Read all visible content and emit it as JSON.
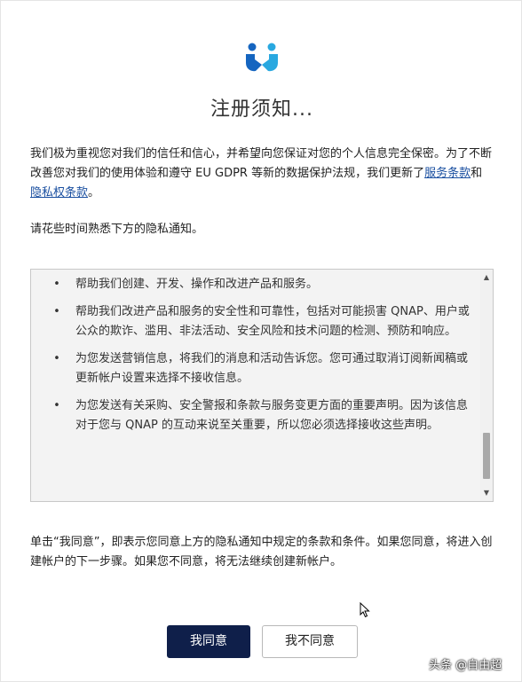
{
  "dialog": {
    "title": "注册须知...",
    "intro": {
      "text_before": "我们极为重视您对我们的信任和信心，并希望向您保证对您的个人信息完全保密。为了不断改善您对我们的使用体验和遵守 EU GDPR 等新的数据保护法规，我们更新了",
      "terms_link": "服务条款",
      "and": "和",
      "privacy_link": "隐私权条款",
      "text_after": "。"
    },
    "hint": "请花些时间熟悉下方的隐私通知。",
    "notice_items": [
      {
        "bullet": "•",
        "text": "帮助我们创建、开发、操作和改进产品和服务。"
      },
      {
        "bullet": "•",
        "text": "帮助我们改进产品和服务的安全性和可靠性，包括对可能损害 QNAP、用户或公众的欺诈、滥用、非法活动、安全风险和技术问题的检测、预防和响应。"
      },
      {
        "bullet": "•",
        "text": "为您发送营销信息，将我们的消息和活动告诉您。您可通过取消订阅新闻稿或更新帐户设置来选择不接收信息。"
      },
      {
        "bullet": "•",
        "text": "为您发送有关采购、安全警报和条款与服务变更方面的重要声明。因为该信息对于您与 QNAP 的互动来说至关重要，所以您必须选择接收这些声明。"
      }
    ],
    "scrollbar": {
      "up": "▲",
      "down": "▼",
      "position": 0.95
    },
    "agree_text": "单击“我同意”，即表示您同意上方的隐私通知中规定的条款和条件。如果您同意，将进入创建帐户的下一步骤。如果您不同意，将无法继续创建新帐户。",
    "buttons": {
      "agree": "我同意",
      "disagree": "我不同意"
    },
    "logo_icon": "qnap-handshake-logo-icon",
    "accent_color": "#0f1f4a",
    "link_color": "#1a4fa0"
  },
  "watermark": "头条 @自由超"
}
